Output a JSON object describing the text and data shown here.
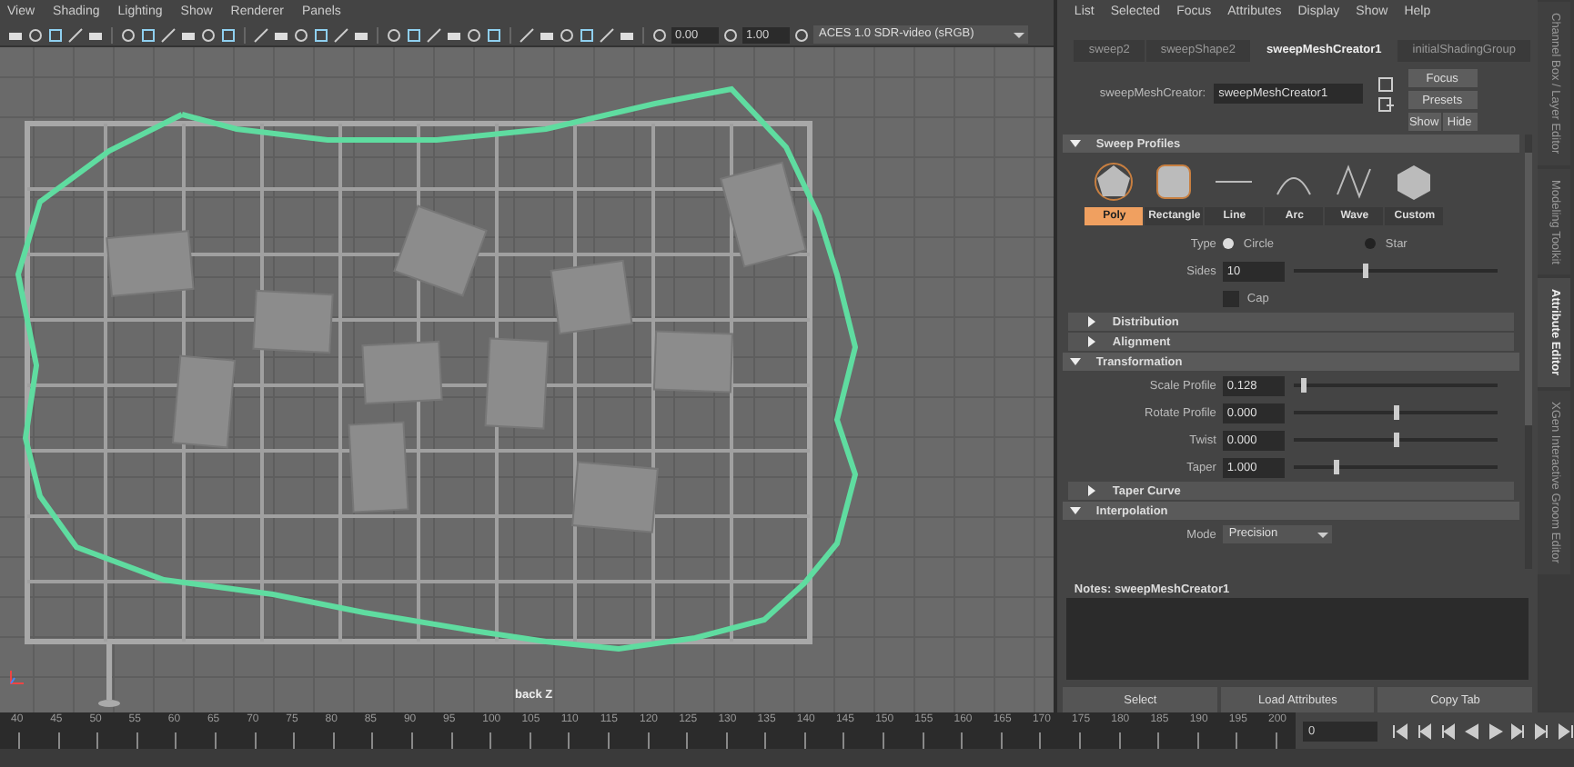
{
  "viewport": {
    "menu": [
      "View",
      "Shading",
      "Lighting",
      "Show",
      "Renderer",
      "Panels"
    ],
    "exposure": "0.00",
    "gamma": "1.00",
    "color_space": "ACES 1.0 SDR-video (sRGB)",
    "camera_label": "back Z"
  },
  "attribute_editor": {
    "menu": [
      "List",
      "Selected",
      "Focus",
      "Attributes",
      "Display",
      "Show",
      "Help"
    ],
    "tabs": [
      {
        "label": "sweep2",
        "selected": false
      },
      {
        "label": "sweepShape2",
        "selected": false
      },
      {
        "label": "sweepMeshCreator1",
        "selected": true
      },
      {
        "label": "initialShadingGroup",
        "selected": false
      }
    ],
    "node_label": "sweepMeshCreator:",
    "node_name": "sweepMeshCreator1",
    "side_buttons": [
      "Focus",
      "Presets",
      "Show",
      "Hide"
    ],
    "sections": [
      {
        "title": "Sweep Profiles",
        "expanded": true,
        "fields": [
          {
            "kind": "profiles",
            "items": [
              {
                "label": "Poly",
                "selected": true
              },
              {
                "label": "Rectangle",
                "selected": false
              },
              {
                "label": "Line",
                "selected": false
              },
              {
                "label": "Arc",
                "selected": false
              },
              {
                "label": "Wave",
                "selected": false
              },
              {
                "label": "Custom",
                "selected": false
              }
            ]
          },
          {
            "kind": "radio",
            "label": "Type",
            "options": [
              {
                "label": "Circle",
                "selected": true
              },
              {
                "label": "Star",
                "selected": false
              }
            ]
          },
          {
            "kind": "slider",
            "label": "Sides",
            "value": "10",
            "level": 0.34
          },
          {
            "kind": "checkbox",
            "label": "Cap",
            "checked": false
          }
        ]
      },
      {
        "title": "Distribution",
        "expanded": false
      },
      {
        "title": "Alignment",
        "expanded": false
      },
      {
        "title": "Transformation",
        "expanded": true,
        "fields": [
          {
            "kind": "slider",
            "label": "Scale Profile",
            "value": "0.128",
            "level": 0.04
          },
          {
            "kind": "slider",
            "label": "Rotate Profile",
            "value": "0.000",
            "level": 0.5
          },
          {
            "kind": "slider",
            "label": "Twist",
            "value": "0.000",
            "level": 0.5
          },
          {
            "kind": "slider",
            "label": "Taper",
            "value": "1.000",
            "level": 0.2
          }
        ]
      },
      {
        "title": "Taper Curve",
        "expanded": false
      },
      {
        "title": "Interpolation",
        "expanded": true,
        "fields": [
          {
            "kind": "dropdown",
            "label": "Mode",
            "value": "Precision"
          }
        ]
      }
    ],
    "notes_label": "Notes:  sweepMeshCreator1",
    "buttons": [
      "Select",
      "Load Attributes",
      "Copy Tab"
    ]
  },
  "side_tabs": [
    {
      "label": "Channel Box / Layer Editor",
      "selected": false
    },
    {
      "label": "Modeling Toolkit",
      "selected": false
    },
    {
      "label": "Attribute Editor",
      "selected": true
    },
    {
      "label": "XGen Interactive Groom Editor",
      "selected": false
    }
  ],
  "timeline": {
    "ticks": [
      "40",
      "45",
      "50",
      "55",
      "60",
      "65",
      "70",
      "75",
      "80",
      "85",
      "90",
      "95",
      "100",
      "105",
      "110",
      "115",
      "120",
      "125",
      "130",
      "135",
      "140",
      "145",
      "150",
      "155",
      "160",
      "165",
      "170",
      "175",
      "180",
      "185",
      "190",
      "195",
      "200"
    ],
    "current_frame": "0"
  }
}
